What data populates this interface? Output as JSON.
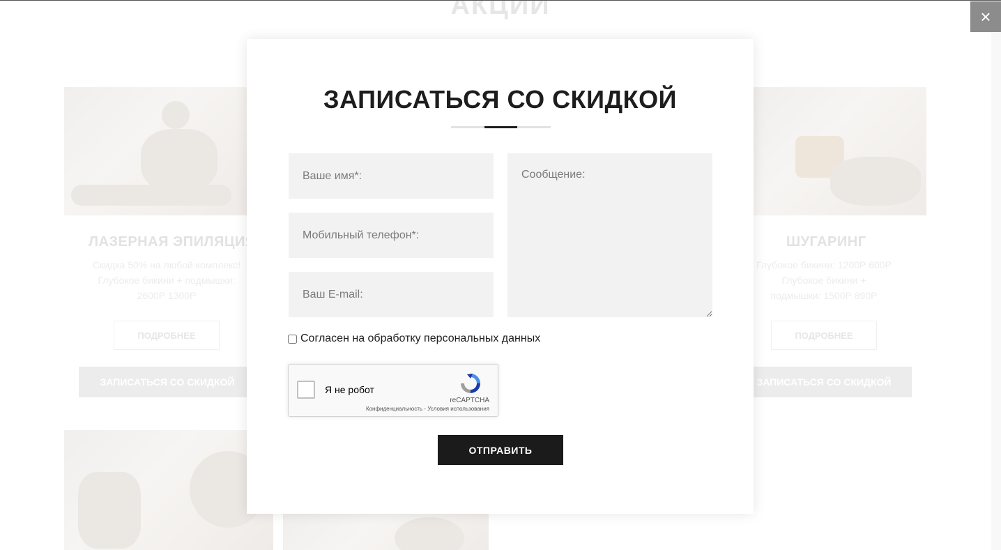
{
  "background": {
    "section_title": "АКЦИИ",
    "cards": [
      {
        "title": "ЛАЗЕРНАЯ ЭПИЛЯЦИЯ",
        "desc_lines": [
          "Скидка 50% на любой комплекс!",
          "Глубокое бикини + подмышки:",
          "2600Р 1300Р"
        ],
        "more_label": "ПОДРОБНЕЕ",
        "cta_label": "ЗАПИСАТЬСЯ СО СКИДКОЙ"
      },
      {
        "title": "ШУГАРИНГ",
        "desc_lines": [
          "Глубокое бикини: 1200Р 600Р",
          "Глубокое бикини +",
          "подмышки: 1500Р 890Р"
        ],
        "more_label": "ПОДРОБНЕЕ",
        "cta_label": "ЗАПИСАТЬСЯ СО СКИДКОЙ"
      }
    ]
  },
  "close_button": {
    "icon": "close-icon",
    "glyph": "×"
  },
  "modal": {
    "title": "ЗАПИСАТЬСЯ СО СКИДКОЙ",
    "fields": {
      "name_placeholder": "Ваше имя*:",
      "phone_placeholder": "Мобильный телефон*:",
      "email_placeholder": "Ваш E-mail:",
      "message_placeholder": "Сообщение:"
    },
    "consent_label": "Согласен на обработку персональных данных",
    "recaptcha": {
      "label": "Я не робот",
      "brand": "reCAPTCHA",
      "links": "Конфиденциальность - Условия использования"
    },
    "submit_label": "ОТПРАВИТЬ"
  },
  "colors": {
    "submit_bg": "#1b1b1b",
    "field_bg": "#f2f2f2",
    "close_bg": "#8c8c8c"
  }
}
